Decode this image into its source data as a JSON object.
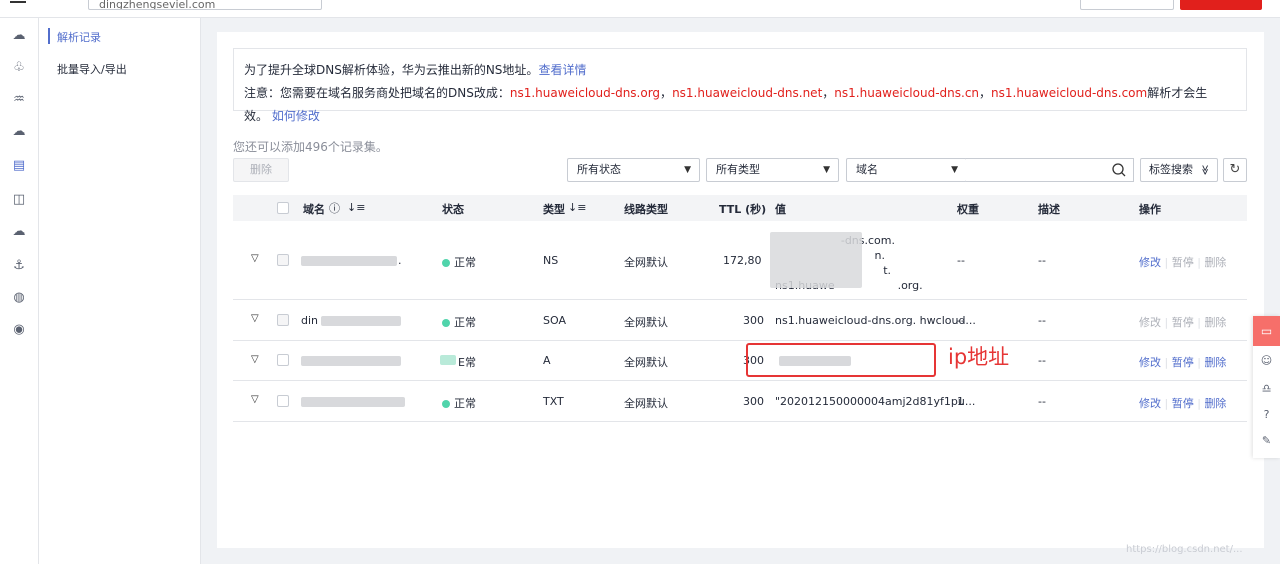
{
  "topbar": {
    "domain_value": "dingzhengseviel.com"
  },
  "rail_icons": [
    "cloud-icon",
    "users-icon",
    "nodes-icon",
    "cloud-server-icon",
    "document-icon",
    "dns-icon",
    "cloud-outline-icon",
    "anchor-icon",
    "globe-icon",
    "ip-icon"
  ],
  "submenu": {
    "records": "解析记录",
    "batch": "批量导入/导出"
  },
  "notice": {
    "line1": "为了提升全球DNS解析体验，华为云推出新的NS地址。",
    "line1_link": "查看详情",
    "line2_prefix": "注意：您需要在域名服务商处把域名的DNS改成：",
    "ns": [
      "ns1.huaweicloud-dns.org",
      "ns1.huaweicloud-dns.net",
      "ns1.huaweicloud-dns.cn",
      "ns1.huaweicloud-dns.com"
    ],
    "sep": "，",
    "line2_suffix": "解析才会生效。",
    "line2_link": "如何修改"
  },
  "quota": "您还可以添加496个记录集。",
  "toolbar": {
    "delete": "删除",
    "status_select": "所有状态",
    "type_select": "所有类型",
    "field_select": "域名",
    "tag_search": "标签搜索",
    "tag_arrow": "≫"
  },
  "table": {
    "headers": {
      "domain": "域名",
      "status": "状态",
      "type": "类型",
      "route": "线路类型",
      "ttl": "TTL (秒)",
      "value": "值",
      "weight": "权重",
      "desc": "描述",
      "ops": "操作"
    },
    "rows": [
      {
        "domain_tail": ".",
        "status": "正常",
        "type": "NS",
        "route": "全网默认",
        "ttl": "172,80",
        "value_lines": [
          "-dns.com.",
          "n.",
          "t.",
          "ns1.huawe                  .org."
        ],
        "weight": "--",
        "desc": "--",
        "op_edit": "修改",
        "op_pause": "暂停",
        "op_delete": "删除"
      },
      {
        "domain_head": "din",
        "status": "正常",
        "type": "SOA",
        "route": "全网默认",
        "ttl": "300",
        "value": "ns1.huaweicloud-dns.org. hwcloud...",
        "weight": "--",
        "desc": "--",
        "op_edit": "修改",
        "op_pause": "暂停",
        "op_delete": "删除"
      },
      {
        "status": "E常",
        "type": "A",
        "route": "全网默认",
        "ttl": "300",
        "value": "",
        "weight": "",
        "desc": "--",
        "op_edit": "修改",
        "op_pause": "暂停",
        "op_delete": "删除"
      },
      {
        "status": "正常",
        "type": "TXT",
        "route": "全网默认",
        "ttl": "300",
        "value": "\"202012150000004amj2d81yf1pu...",
        "weight": "1",
        "desc": "--",
        "op_edit": "修改",
        "op_pause": "暂停",
        "op_delete": "删除"
      }
    ]
  },
  "annotation": "ip地址",
  "right_tools": [
    "chat-icon",
    "smile-icon",
    "headset-icon",
    "help-icon",
    "feedback-icon"
  ],
  "watermark": "https://blog.csdn.net/...",
  "colors": {
    "accent": "#526ecc",
    "danger": "#e1201c",
    "status_ok": "#50d4ab",
    "annotation": "#e63535"
  }
}
